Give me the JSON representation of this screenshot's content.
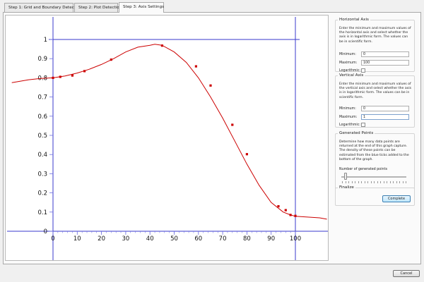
{
  "tabs": [
    {
      "label": "Step 1: Grid and Boundary Detection",
      "active": false
    },
    {
      "label": "Step 2: Plot Detection",
      "active": false
    },
    {
      "label": "Step 3: Axis Settings",
      "active": true
    }
  ],
  "horizontal_axis": {
    "title": "Horizontal Axis",
    "description": "Enter the minimum and maximum values of the horizontal axis and select whether the axis is in logarithmic form. The values can be in scientific form.",
    "minimum_label": "Minimum:",
    "minimum_value": "0",
    "maximum_label": "Maximum:",
    "maximum_value": "100",
    "log_label": "Logarithmic:",
    "log_checked": false
  },
  "vertical_axis": {
    "title": "Vertical Axis",
    "description": "Enter the minimum and maximum values of the vertical axis and select whether the axis is in logarithmic form. The values can be in scientific form.",
    "minimum_label": "Minimum:",
    "minimum_value": "0",
    "maximum_label": "Maximum:",
    "maximum_value": "1",
    "log_label": "Logarithmic:",
    "log_checked": false
  },
  "generated_points": {
    "title": "Generated Points",
    "description": "Determine how many data points are returned at the end of this graph capture. The density of these points can be estimated from the blue ticks added to the bottom of the graph.",
    "slider_label": "Number of generated points",
    "slider_level": 0.05
  },
  "finalize": {
    "title": "Finalize",
    "complete_label": "Complete"
  },
  "cancel_label": "Cancel",
  "colors": {
    "curve": "#cc0000",
    "axis_lines": "#3a3acc",
    "tick_marks": "#6e6ee0"
  },
  "chart_data": {
    "type": "line",
    "title": "",
    "xlabel": "",
    "ylabel": "",
    "xlim": [
      0,
      100
    ],
    "ylim": [
      0,
      1
    ],
    "x_ticks": [
      "0",
      "10",
      "20",
      "30",
      "40",
      "50",
      "60",
      "70",
      "80",
      "90",
      "100"
    ],
    "y_ticks": [
      "0",
      "0.1",
      "0.2",
      "0.3",
      "0.4",
      "0.5",
      "0.6",
      "0.7",
      "0.8",
      "0.9",
      "1"
    ],
    "grid": false,
    "series": [
      {
        "curve_x": [
          -17,
          -10,
          -5,
          0,
          5,
          10,
          15,
          20,
          25,
          30,
          35,
          40,
          42,
          45,
          50,
          55,
          60,
          65,
          70,
          75,
          80,
          85,
          90,
          95,
          98,
          100,
          105,
          110,
          113
        ],
        "curve_y": [
          0.775,
          0.79,
          0.797,
          0.8,
          0.81,
          0.825,
          0.845,
          0.87,
          0.9,
          0.935,
          0.96,
          0.97,
          0.975,
          0.97,
          0.935,
          0.88,
          0.8,
          0.7,
          0.59,
          0.47,
          0.35,
          0.24,
          0.15,
          0.1,
          0.085,
          0.078,
          0.074,
          0.07,
          0.063
        ]
      }
    ],
    "markers": {
      "x": [
        0,
        3,
        8,
        13,
        24,
        45,
        59,
        65,
        74,
        80,
        93,
        96,
        98,
        100
      ],
      "y": [
        0.8,
        0.805,
        0.812,
        0.835,
        0.895,
        0.968,
        0.86,
        0.76,
        0.555,
        0.402,
        0.13,
        0.11,
        0.085,
        0.08
      ]
    }
  }
}
